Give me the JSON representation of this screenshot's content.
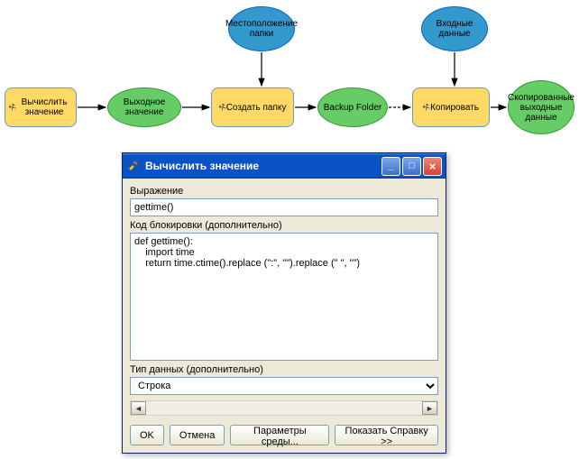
{
  "diagram": {
    "nodes": {
      "calc": {
        "label": "Вычислить значение"
      },
      "outval": {
        "label": "Выходное значение"
      },
      "mkdir": {
        "label": "Создать папку"
      },
      "folderloc": {
        "label": "Местоположение папки"
      },
      "backup": {
        "label": "Backup Folder"
      },
      "copy": {
        "label": "Копировать"
      },
      "inputdata": {
        "label": "Входные данные"
      },
      "copied": {
        "label": "Скопированные выходные данные"
      }
    }
  },
  "dialog": {
    "title": "Вычислить значение",
    "expr_label": "Выражение",
    "expr_value": "gettime()",
    "code_label": "Код блокировки (дополнительно)",
    "code_value": "def gettime():\n    import time\n    return time.ctime().replace (\":\", \"\").replace (\" \", \"\")",
    "type_label": "Тип данных (дополнительно)",
    "type_value": "Строка",
    "buttons": {
      "ok": "OK",
      "cancel": "Отмена",
      "env": "Параметры среды...",
      "help": "Показать Справку >>"
    }
  }
}
